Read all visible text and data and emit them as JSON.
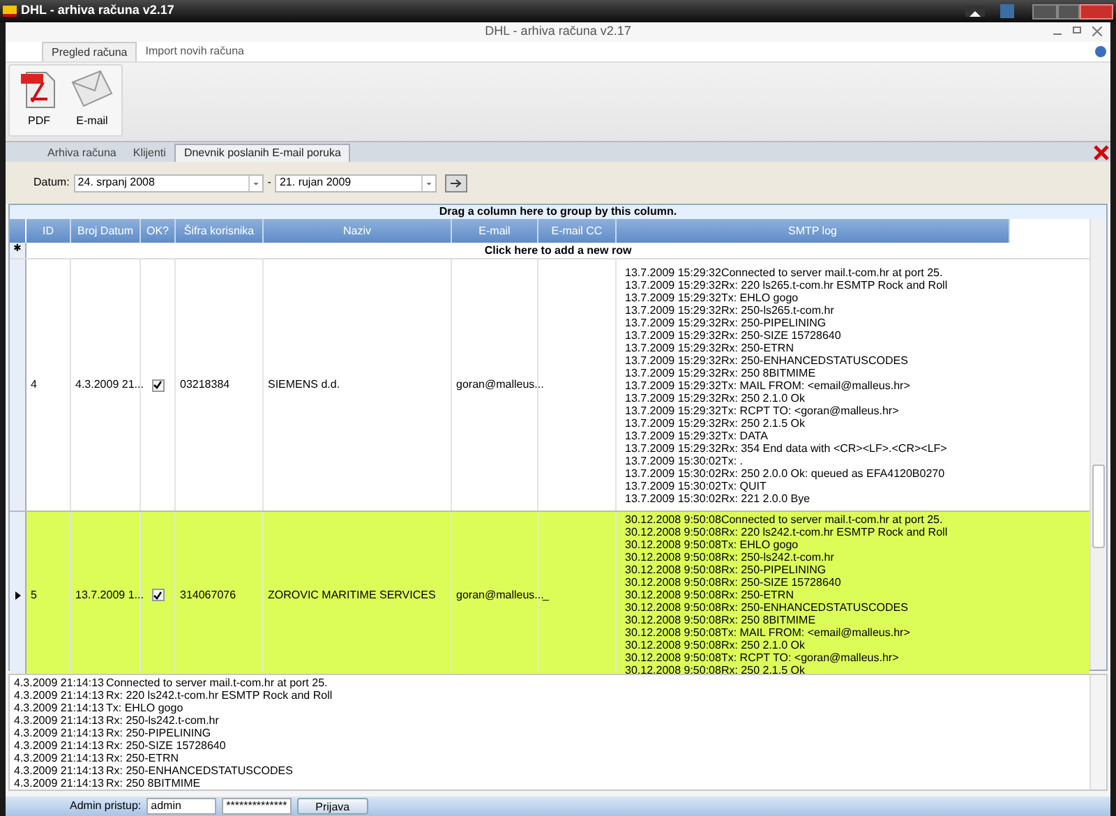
{
  "window": {
    "title": "DHL  - arhiva računa v2.17"
  },
  "inner_title": "DHL  - arhiva računa v2.17",
  "ribbon_tabs": [
    {
      "label": "Pregled računa",
      "selected": true
    },
    {
      "label": "Import novih računa",
      "selected": false
    }
  ],
  "ribbon_buttons": [
    {
      "label": "PDF",
      "kind": "pdf"
    },
    {
      "label": "E-mail",
      "kind": "email"
    }
  ],
  "tabs": [
    {
      "label": "Arhiva računa",
      "selected": false
    },
    {
      "label": "Klijenti",
      "selected": false
    },
    {
      "label": "Dnevnik poslanih E-mail poruka",
      "selected": true
    }
  ],
  "filter": {
    "label": "Datum:",
    "from": "24. srpanj 2008",
    "separator": "-",
    "to": "21. rujan 2009"
  },
  "grid": {
    "group_hint": "Drag a column here to group by this column.",
    "columns": [
      "ID",
      "Broj Datum",
      "OK?",
      "Šifra korisnika",
      "Naziv",
      "E-mail",
      "E-mail CC",
      "SMTP log"
    ],
    "new_row_marker": "✱",
    "add_row_hint": "Click here to add a new row",
    "rows": [
      {
        "id": "4",
        "date": "4.3.2009 21...",
        "ok": true,
        "code": "03218384",
        "name": "SIEMENS d.d.",
        "email": "goran@malleus...",
        "email_cc": "",
        "selected": false,
        "log": [
          "13.7.2009 15:29:32Connected to server mail.t-com.hr at port 25.",
          "13.7.2009 15:29:32Rx: 220 ls265.t-com.hr ESMTP Rock and Roll",
          "13.7.2009 15:29:32Tx: EHLO gogo",
          "13.7.2009 15:29:32Rx: 250-ls265.t-com.hr",
          "13.7.2009 15:29:32Rx: 250-PIPELINING",
          "13.7.2009 15:29:32Rx: 250-SIZE 15728640",
          "13.7.2009 15:29:32Rx: 250-ETRN",
          "13.7.2009 15:29:32Rx: 250-ENHANCEDSTATUSCODES",
          "13.7.2009 15:29:32Rx: 250 8BITMIME",
          "13.7.2009 15:29:32Tx: MAIL FROM: <email@malleus.hr>",
          "13.7.2009 15:29:32Rx: 250 2.1.0 Ok",
          "13.7.2009 15:29:32Tx: RCPT TO: <goran@malleus.hr>",
          "13.7.2009 15:29:32Rx: 250 2.1.5 Ok",
          "13.7.2009 15:29:32Tx: DATA",
          "13.7.2009 15:29:32Rx: 354 End data with <CR><LF>.<CR><LF>",
          "13.7.2009 15:30:02Tx: .",
          "13.7.2009 15:30:02Rx: 250 2.0.0 Ok: queued as EFA4120B0270",
          "13.7.2009 15:30:02Tx: QUIT",
          "13.7.2009 15:30:02Rx: 221 2.0.0 Bye"
        ]
      },
      {
        "id": "5",
        "date": "13.7.2009 1...",
        "ok": true,
        "code": "314067076",
        "name": "ZOROVIC MARITIME SERVICES",
        "email": "goran@malleus...",
        "email_cc": "_",
        "selected": true,
        "log": [
          "30.12.2008 9:50:08Connected to server mail.t-com.hr at port 25.",
          "30.12.2008 9:50:08Rx: 220 ls242.t-com.hr ESMTP Rock and Roll",
          "30.12.2008 9:50:08Tx: EHLO gogo",
          "30.12.2008 9:50:08Rx: 250-ls242.t-com.hr",
          "30.12.2008 9:50:08Rx: 250-PIPELINING",
          "30.12.2008 9:50:08Rx: 250-SIZE 15728640",
          "30.12.2008 9:50:08Rx: 250-ETRN",
          "30.12.2008 9:50:08Rx: 250-ENHANCEDSTATUSCODES",
          "30.12.2008 9:50:08Rx: 250 8BITMIME",
          "30.12.2008 9:50:08Tx: MAIL FROM: <email@malleus.hr>",
          "30.12.2008 9:50:08Rx: 250 2.1.0 Ok",
          "30.12.2008 9:50:08Tx: RCPT TO: <goran@malleus.hr>",
          "30.12.2008 9:50:08Rx: 250 2.1.5 Ok"
        ]
      }
    ]
  },
  "log_panel": [
    {
      "time": "4.3.2009 21:14:13",
      "message": "Connected to server mail.t-com.hr at port 25."
    },
    {
      "time": "4.3.2009 21:14:13",
      "message": "Rx: 220 ls242.t-com.hr ESMTP Rock and Roll"
    },
    {
      "time": "4.3.2009 21:14:13",
      "message": "Tx: EHLO gogo"
    },
    {
      "time": "4.3.2009 21:14:13",
      "message": "Rx: 250-ls242.t-com.hr"
    },
    {
      "time": "4.3.2009 21:14:13",
      "message": "Rx: 250-PIPELINING"
    },
    {
      "time": "4.3.2009 21:14:13",
      "message": "Rx: 250-SIZE 15728640"
    },
    {
      "time": "4.3.2009 21:14:13",
      "message": "Rx: 250-ETRN"
    },
    {
      "time": "4.3.2009 21:14:13",
      "message": "Rx: 250-ENHANCEDSTATUSCODES"
    },
    {
      "time": "4.3.2009 21:14:13",
      "message": "Rx: 250 8BITMIME"
    }
  ],
  "login": {
    "label": "Admin pristup:",
    "user": "admin",
    "password": "**************",
    "button": "Prijava"
  }
}
